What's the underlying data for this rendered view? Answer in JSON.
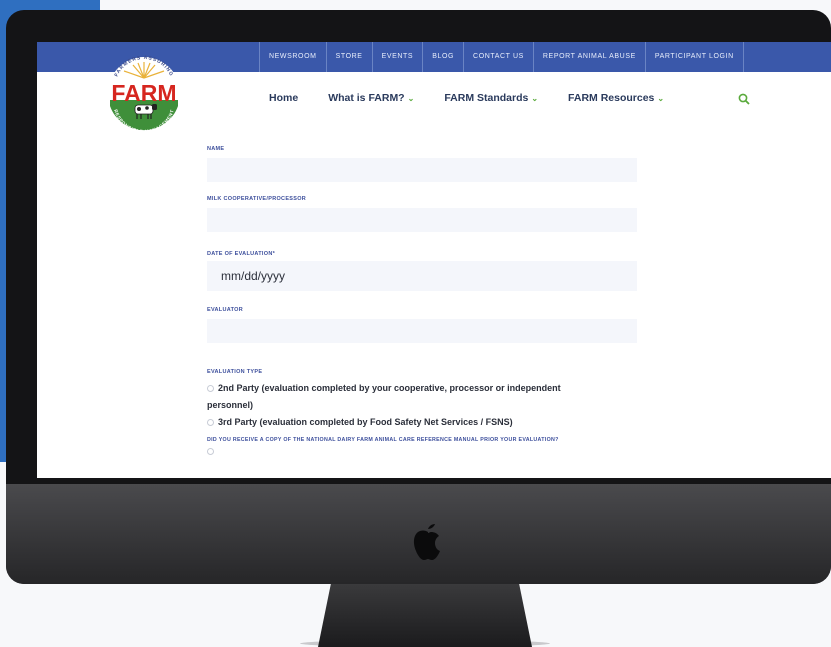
{
  "top_nav": [
    "NEWSROOM",
    "STORE",
    "EVENTS",
    "BLOG",
    "CONTACT US",
    "REPORT ANIMAL ABUSE",
    "PARTICIPANT LOGIN"
  ],
  "logo": {
    "wordmark": "FARM",
    "arc_top": "FARMERS ASSURING",
    "arc_bottom": "RESPONSIBLE MANAGEMENT"
  },
  "main_nav": [
    {
      "label": "Home",
      "dropdown": false
    },
    {
      "label": "What is FARM?",
      "dropdown": true
    },
    {
      "label": "FARM Standards",
      "dropdown": true
    },
    {
      "label": "FARM Resources",
      "dropdown": true
    }
  ],
  "form": {
    "name_label": "NAME",
    "milk_label": "MILK COOPERATIVE/PROCESSOR",
    "date_label": "DATE OF EVALUATION*",
    "date_placeholder": "mm/dd/yyyy",
    "evaluator_label": "EVALUATOR",
    "type_label": "EVALUATION TYPE",
    "option_2nd_a": "2nd Party (evaluation completed by your cooperative, processor or independent",
    "option_2nd_b": "personnel)",
    "option_3rd": "3rd Party (evaluation completed by Food Safety Net Services / FSNS)",
    "question": "DID YOU RECEIVE A COPY OF THE NATIONAL DAIRY FARM ANIMAL CARE REFERENCE MANUAL PRIOR YOUR EVALUATION?"
  },
  "colors": {
    "top_bar": "#3a58aa",
    "accent_green": "#5aaa3c",
    "logo_red": "#d6261f",
    "label_blue": "#3d4f9c"
  }
}
